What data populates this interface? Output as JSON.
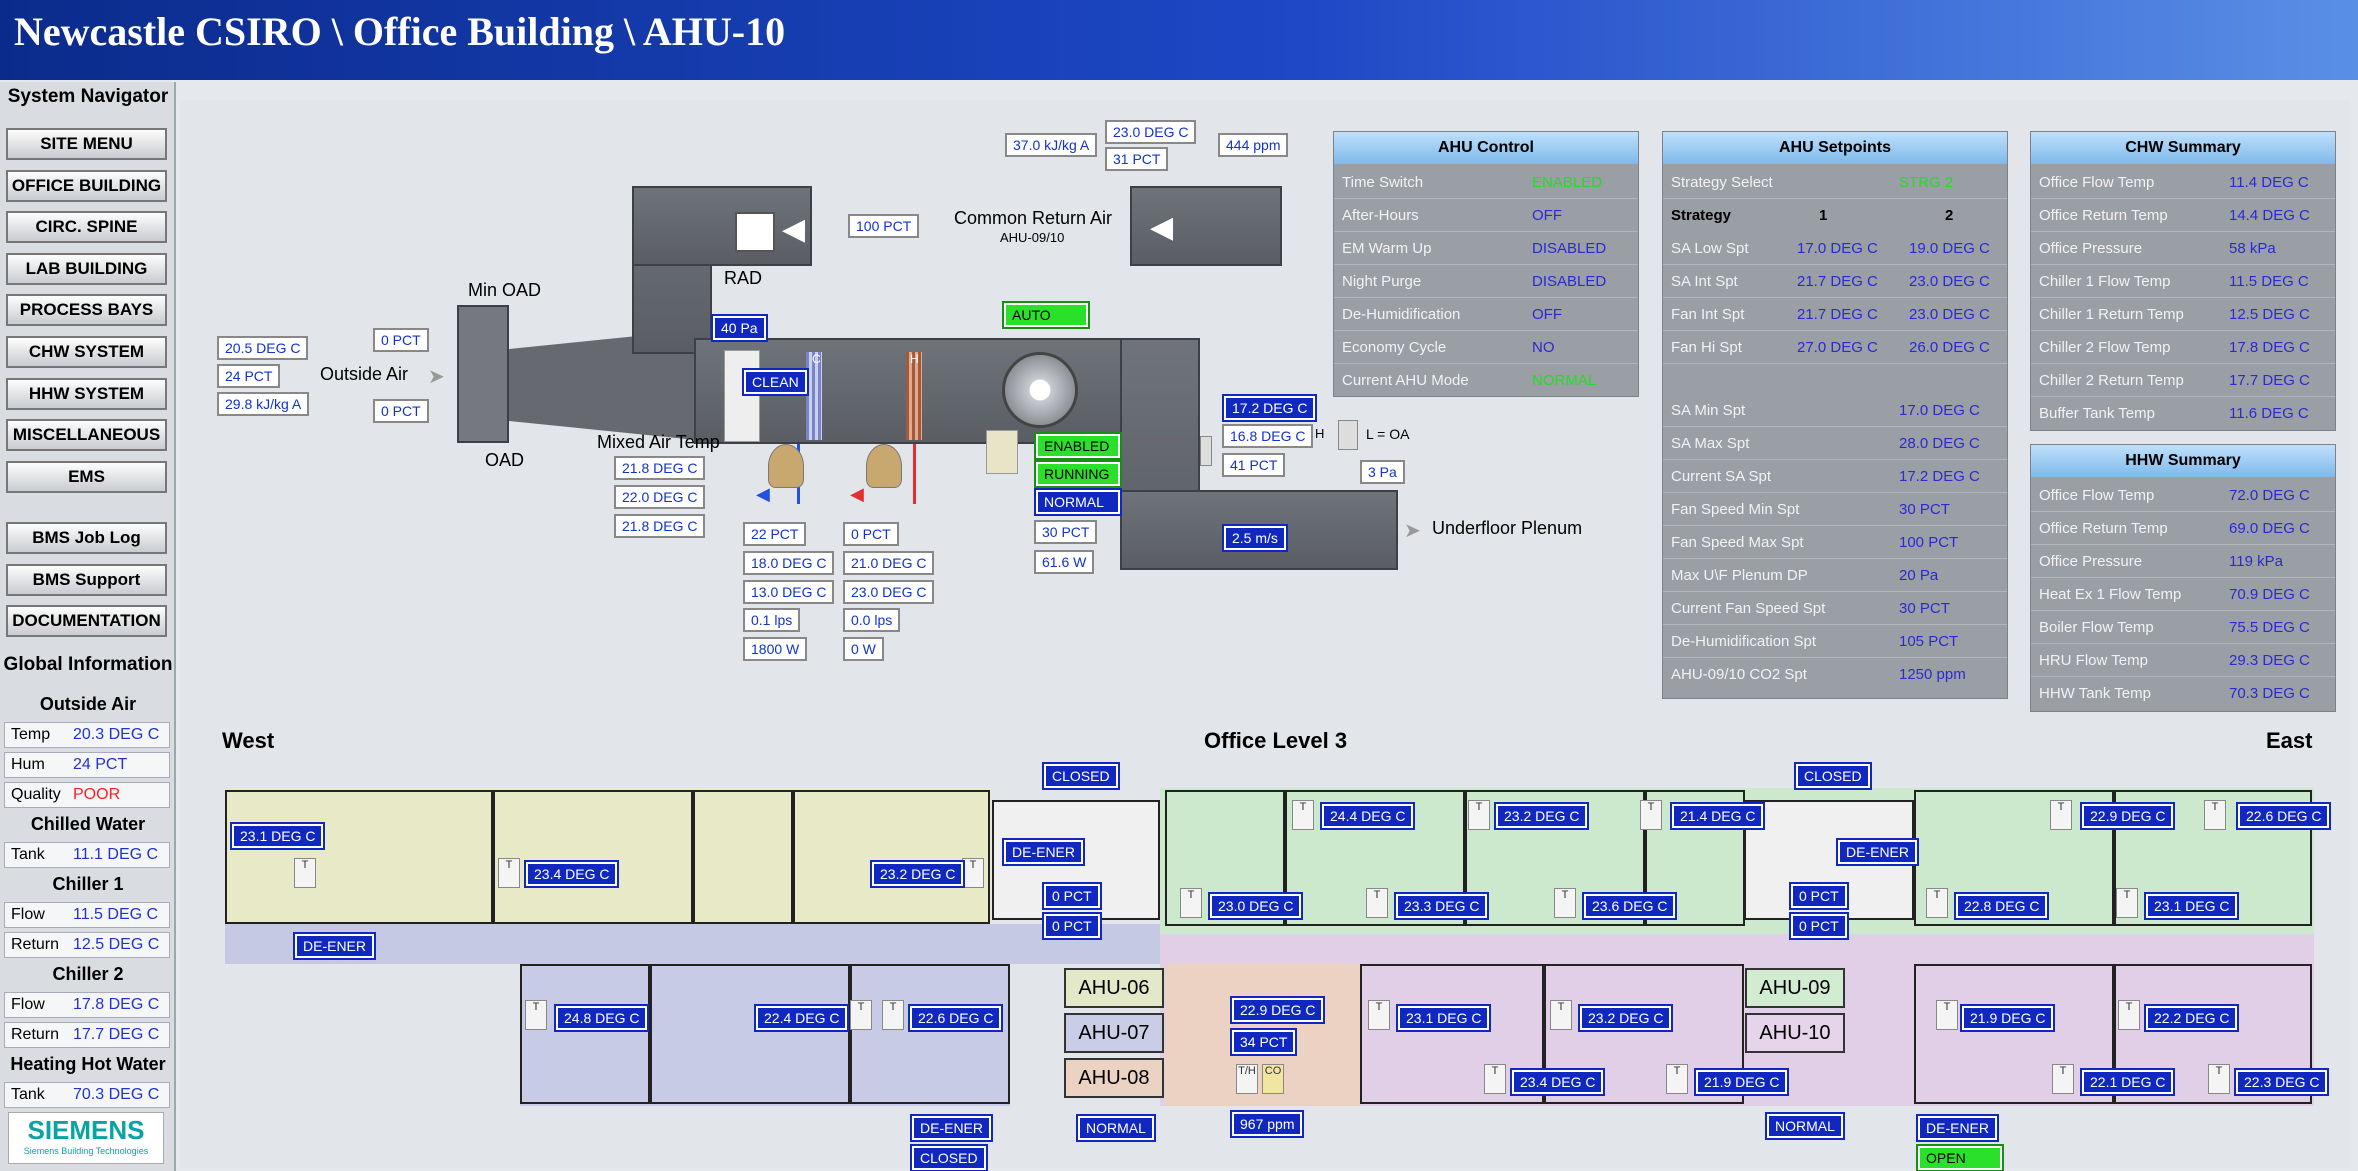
{
  "header": {
    "title": "Newcastle CSIRO \\ Office Building \\ AHU-10"
  },
  "nav": {
    "title": "System Navigator",
    "buttons": [
      "SITE MENU",
      "OFFICE BUILDING",
      "CIRC. SPINE",
      "LAB BUILDING",
      "PROCESS BAYS",
      "CHW SYSTEM",
      "HHW SYSTEM",
      "MISCELLANEOUS",
      "EMS",
      "BMS Job Log",
      "BMS Support",
      "DOCUMENTATION"
    ],
    "global_title": "Global Information",
    "outside_air": {
      "title": "Outside Air",
      "temp_label": "Temp",
      "temp": "20.3 DEG C",
      "hum_label": "Hum",
      "hum": "24 PCT",
      "quality_label": "Quality",
      "quality": "POOR"
    },
    "chilled_water": {
      "title": "Chilled Water",
      "tank_label": "Tank",
      "tank": "11.1 DEG C"
    },
    "chiller1": {
      "title": "Chiller 1",
      "flow_label": "Flow",
      "flow": "11.5 DEG C",
      "return_label": "Return",
      "return": "12.5 DEG C"
    },
    "chiller2": {
      "title": "Chiller 2",
      "flow_label": "Flow",
      "flow": "17.8 DEG C",
      "return_label": "Return",
      "return": "17.7 DEG C"
    },
    "hhw": {
      "title": "Heating Hot Water",
      "tank_label": "Tank",
      "tank": "70.3 DEG C"
    },
    "logo": "SIEMENS",
    "logo_sub": "Siemens Building Technologies"
  },
  "ahu": {
    "oa_temp": "20.5 DEG C",
    "oa_hum": "24 PCT",
    "oa_enth": "29.8 kJ/kg A",
    "outside_air_label": "Outside Air",
    "min_oad_pct": "0 PCT",
    "oad_pct": "0 PCT",
    "min_oad_label": "Min OAD",
    "oad_label": "OAD",
    "mixed_air_label": "Mixed Air Temp",
    "mat1": "21.8 DEG C",
    "mat2": "22.0 DEG C",
    "mat3": "21.8 DEG C",
    "rad_label": "RAD",
    "rad_pct": "100 PCT",
    "ra_enth": "37.0 kJ/kg A",
    "ra_temp": "23.0 DEG C",
    "ra_hum": "31 PCT",
    "ra_co2": "444 ppm",
    "common_return_label": "Common Return Air",
    "common_return_sub": "AHU-09/10",
    "filter_dp": "40 Pa",
    "filter_status": "CLEAN",
    "cc": "C",
    "hh": "H",
    "mode": "AUTO",
    "chw_valve": "22 PCT",
    "chw_temp1": "18.0 DEG C",
    "chw_temp2": "13.0 DEG C",
    "chw_flow": "0.1 lps",
    "chw_power": "1800 W",
    "hhw_valve": "0 PCT",
    "hhw_temp1": "21.0 DEG C",
    "hhw_temp2": "23.0 DEG C",
    "hhw_flow": "0.0 lps",
    "hhw_power": "0 W",
    "fan_enabled": "ENABLED",
    "fan_running": "RUNNING",
    "fan_normal": "NORMAL",
    "fan_speed": "30 PCT",
    "fan_power": "61.6 W",
    "sa_temp1": "17.2 DEG C",
    "sa_temp2": "16.8 DEG C",
    "sa_hum": "41 PCT",
    "h_label": "H",
    "loa_label": "L = OA",
    "plenum_dp": "3 Pa",
    "velocity": "2.5 m/s",
    "underfloor_label": "Underfloor Plenum"
  },
  "ahu_control": {
    "title": "AHU Control",
    "rows": [
      {
        "k": "Time Switch",
        "v": "ENABLED",
        "g": true
      },
      {
        "k": "After-Hours",
        "v": "OFF"
      },
      {
        "k": "EM Warm Up",
        "v": "DISABLED"
      },
      {
        "k": "Night Purge",
        "v": "DISABLED"
      },
      {
        "k": "De-Humidification",
        "v": "OFF"
      },
      {
        "k": "Economy Cycle",
        "v": "NO"
      },
      {
        "k": "Current AHU Mode",
        "v": "NORMAL",
        "g": true
      }
    ]
  },
  "ahu_setpoints": {
    "title": "AHU Setpoints",
    "select_label": "Strategy Select",
    "select_value": "STRG 2",
    "strategy_label": "Strategy",
    "col1": "1",
    "col2": "2",
    "rows": [
      {
        "k": "SA Low Spt",
        "a": "17.0 DEG C",
        "b": "19.0 DEG C"
      },
      {
        "k": "SA Int Spt",
        "a": "21.7 DEG C",
        "b": "23.0 DEG C"
      },
      {
        "k": "Fan Int Spt",
        "a": "21.7 DEG C",
        "b": "23.0 DEG C"
      },
      {
        "k": "Fan Hi Spt",
        "a": "27.0 DEG C",
        "b": "26.0 DEG C"
      }
    ],
    "rows2": [
      {
        "k": "SA Min Spt",
        "v": "17.0 DEG C"
      },
      {
        "k": "SA Max Spt",
        "v": "28.0 DEG C"
      },
      {
        "k": "Current SA Spt",
        "v": "17.2 DEG C"
      },
      {
        "k": "Fan Speed Min Spt",
        "v": "30 PCT"
      },
      {
        "k": "Fan Speed Max Spt",
        "v": "100 PCT"
      },
      {
        "k": "Max U\\F Plenum DP",
        "v": "20 Pa"
      },
      {
        "k": "Current Fan Speed Spt",
        "v": "30 PCT"
      },
      {
        "k": "De-Humidification Spt",
        "v": "105 PCT"
      },
      {
        "k": "AHU-09/10 CO2 Spt",
        "v": "1250 ppm"
      }
    ]
  },
  "chw_summary": {
    "title": "CHW Summary",
    "rows": [
      {
        "k": "Office Flow Temp",
        "v": "11.4 DEG C"
      },
      {
        "k": "Office Return Temp",
        "v": "14.4 DEG C"
      },
      {
        "k": "Office Pressure",
        "v": "58 kPa"
      },
      {
        "k": "Chiller 1 Flow Temp",
        "v": "11.5 DEG C"
      },
      {
        "k": "Chiller 1 Return Temp",
        "v": "12.5 DEG C"
      },
      {
        "k": "Chiller 2 Flow Temp",
        "v": "17.8 DEG C"
      },
      {
        "k": "Chiller 2 Return Temp",
        "v": "17.7 DEG C"
      },
      {
        "k": "Buffer Tank Temp",
        "v": "11.6 DEG C"
      }
    ]
  },
  "hhw_summary": {
    "title": "HHW Summary",
    "rows": [
      {
        "k": "Office Flow Temp",
        "v": "72.0 DEG C"
      },
      {
        "k": "Office Return Temp",
        "v": "69.0 DEG C"
      },
      {
        "k": "Office Pressure",
        "v": "119 kPa"
      },
      {
        "k": "Heat Ex 1 Flow Temp",
        "v": "70.9 DEG C"
      },
      {
        "k": "Boiler Flow Temp",
        "v": "75.5 DEG C"
      },
      {
        "k": "HRU Flow Temp",
        "v": "29.3 DEG C"
      },
      {
        "k": "HHW Tank Temp",
        "v": "70.3 DEG C"
      }
    ]
  },
  "floor": {
    "west": "West",
    "title": "Office Level 3",
    "east": "East",
    "closed1": "CLOSED",
    "closed2": "CLOSED",
    "closed3": "CLOSED",
    "open": "OPEN",
    "deener1": "DE-ENER",
    "deener2": "DE-ENER",
    "deener3": "DE-ENER",
    "deener4": "DE-ENER",
    "deener5": "DE-ENER",
    "pct1": "0 PCT",
    "pct2": "0 PCT",
    "pct3": "0 PCT",
    "pct4": "0 PCT",
    "normal1": "NORMAL",
    "normal2": "NORMAL",
    "ahu06": "AHU-06",
    "ahu07": "AHU-07",
    "ahu08": "AHU-08",
    "ahu09": "AHU-09",
    "ahu10": "AHU-10",
    "co2": "967 ppm",
    "rh": "34 PCT",
    "th": "T/H",
    "co": "CO",
    "t": "T",
    "temps": [
      "23.1 DEG C",
      "23.4 DEG C",
      "23.2 DEG C",
      "24.4 DEG C",
      "23.2 DEG C",
      "21.4 DEG C",
      "22.9 DEG C",
      "22.6 DEG C",
      "23.0 DEG C",
      "23.3 DEG C",
      "23.6 DEG C",
      "22.8 DEG C",
      "23.1 DEG C",
      "24.8 DEG C",
      "22.4 DEG C",
      "22.6 DEG C",
      "22.9 DEG C",
      "23.1 DEG C",
      "23.2 DEG C",
      "23.4 DEG C",
      "21.9 DEG C",
      "21.9 DEG C",
      "22.2 DEG C",
      "22.1 DEG C",
      "22.3 DEG C"
    ]
  },
  "colors": {
    "header": "#1d48c6",
    "value": "#1133cc",
    "status_green": "#2be02b",
    "alert": "#ff2020"
  }
}
